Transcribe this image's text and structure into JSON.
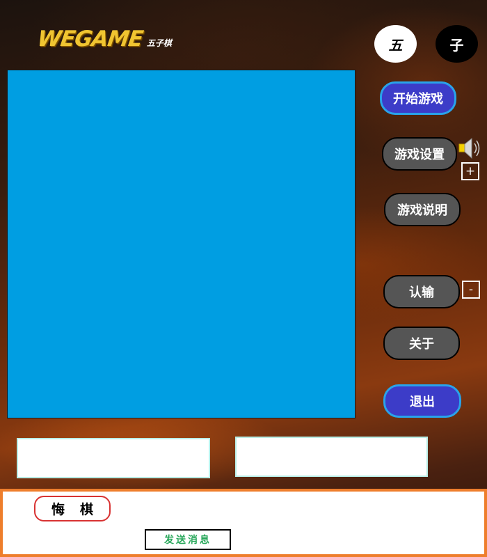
{
  "header": {
    "logo_main": "WEGAME",
    "logo_sub": "五子棋"
  },
  "stones": {
    "white_label": "五",
    "black_label": "子"
  },
  "menu": {
    "start": "开始游戏",
    "settings": "游戏设置",
    "help": "游戏说明",
    "resign": "认输",
    "about": "关于",
    "quit": "退出"
  },
  "volume": {
    "icon": "speaker-icon",
    "increase": "+",
    "decrease": "-"
  },
  "bottom": {
    "regret": "悔棋",
    "send_message": "发送消息"
  },
  "colors": {
    "board": "#009ee2",
    "button_gray": "#555555",
    "button_blue": "#3c3cc8",
    "logo_gold": "#f0c531",
    "panel_border": "#ee7e2c",
    "regret_border": "#d83232",
    "send_text": "#2aa85c"
  }
}
